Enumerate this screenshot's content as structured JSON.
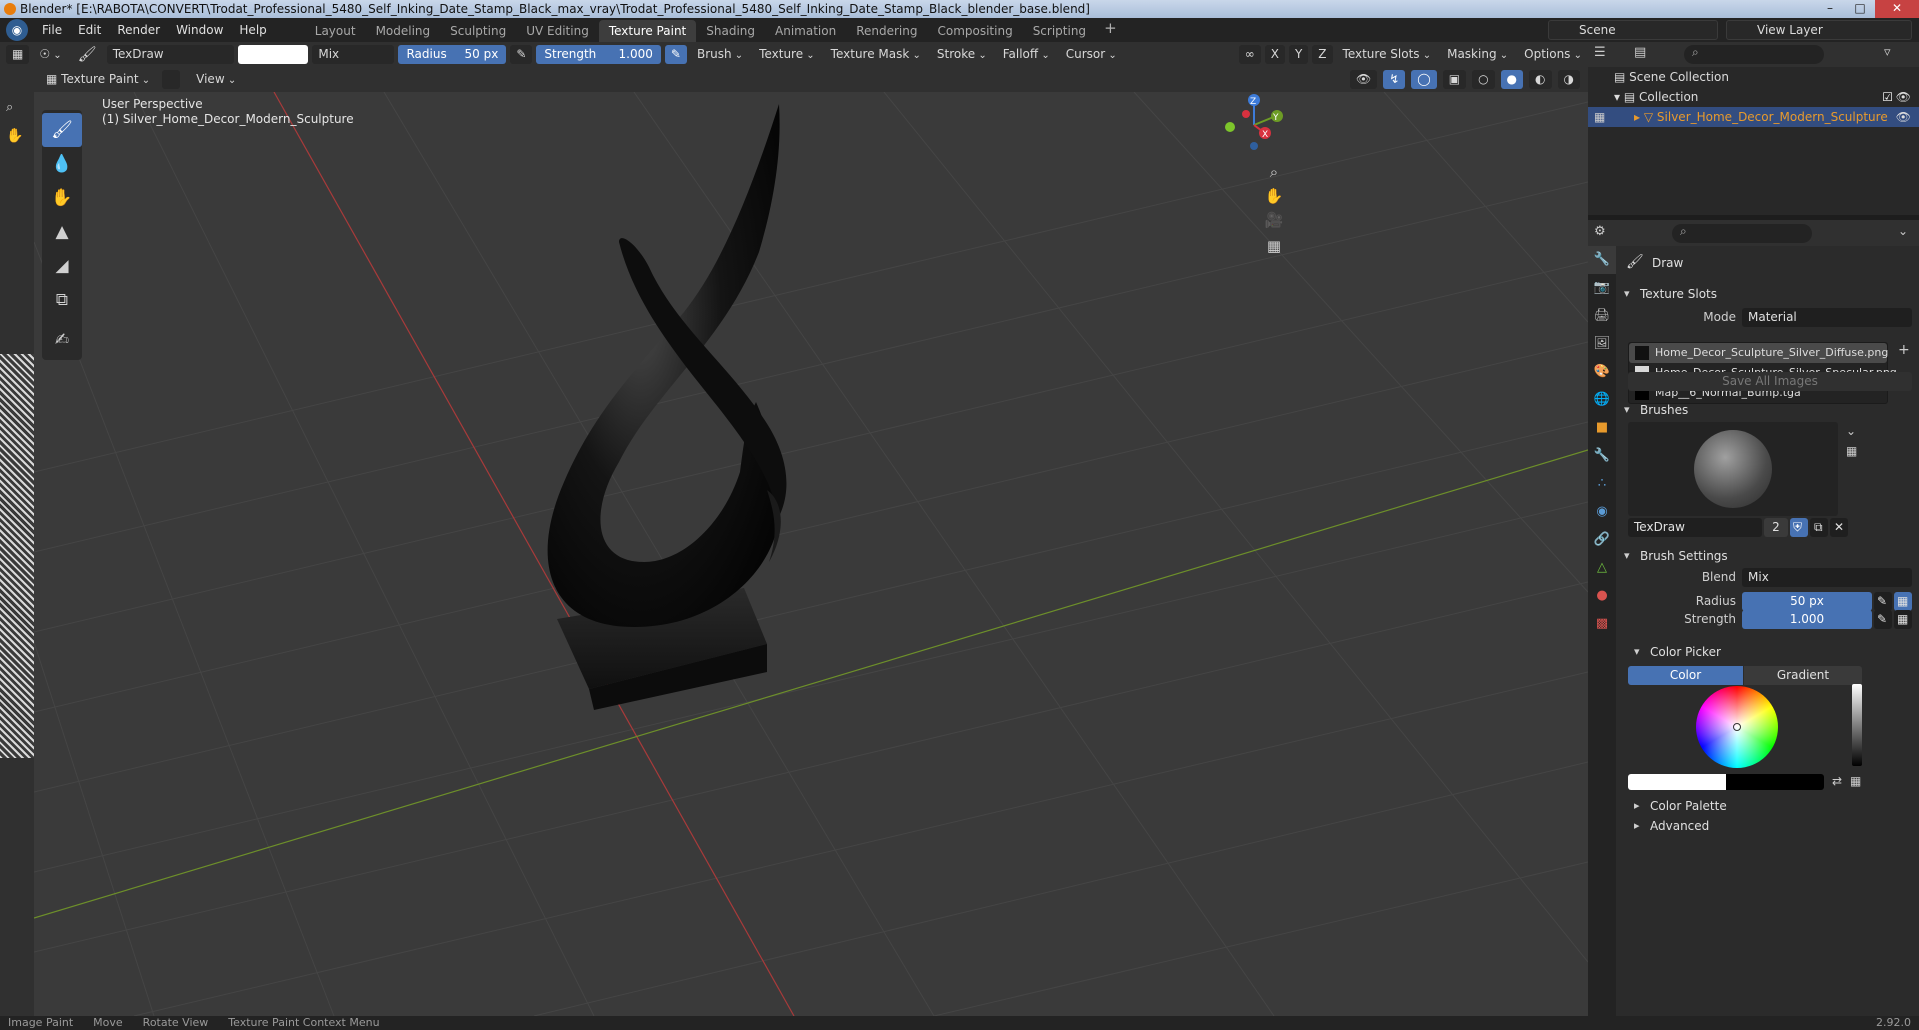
{
  "window": {
    "title": "Blender* [E:\\RABOTA\\CONVERT\\Trodat_Professional_5480_Self_Inking_Date_Stamp_Black_max_vray\\Trodat_Professional_5480_Self_Inking_Date_Stamp_Black_blender_base.blend]"
  },
  "menu": {
    "items": [
      "File",
      "Edit",
      "Render",
      "Window",
      "Help"
    ]
  },
  "workspaces": {
    "tabs": [
      "Layout",
      "Modeling",
      "Sculpting",
      "UV Editing",
      "Texture Paint",
      "Shading",
      "Animation",
      "Rendering",
      "Compositing",
      "Scripting"
    ],
    "active": "Texture Paint",
    "scene": "Scene",
    "view_layer": "View Layer"
  },
  "tool_header": {
    "brush_name": "TexDraw",
    "blend_mode": "Mix",
    "radius_label": "Radius",
    "radius_value": "50 px",
    "strength_label": "Strength",
    "strength_value": "1.000",
    "menus": [
      "Brush",
      "Texture",
      "Texture Mask",
      "Stroke",
      "Falloff",
      "Cursor"
    ],
    "axis": [
      "X",
      "Y",
      "Z"
    ],
    "right_menus": [
      "Texture Slots",
      "Masking",
      "Options"
    ]
  },
  "viewport_header": {
    "mode": "Texture Paint",
    "view_menu": "View"
  },
  "viewport": {
    "perspective": "User Perspective",
    "object_label": "(1) Silver_Home_Decor_Modern_Sculpture",
    "gizmo_axes": [
      "Z",
      "Y",
      "X"
    ],
    "colors": {
      "background": "#3a3a3a",
      "grid": "#454545",
      "x_axis": "#a83a3a",
      "y_axis": "#6d8f2a",
      "active_tool": "#4772b3"
    }
  },
  "toolbar": {
    "tools": [
      "draw-brush",
      "soften",
      "smear",
      "clone",
      "fill",
      "mask",
      "annotate"
    ]
  },
  "outliner": {
    "scene_collection": "Scene Collection",
    "collection": "Collection",
    "object": "Silver_Home_Decor_Modern_Sculpture"
  },
  "properties": {
    "tool_name": "Draw",
    "texture_slots": {
      "title": "Texture Slots",
      "mode_label": "Mode",
      "mode_value": "Material",
      "slots": [
        "Home_Decor_Sculpture_Silver_Diffuse.png",
        "Home_Decor_Sculpture_Silver_Specular.png",
        "Map__6_Normal_Bump.tga"
      ],
      "save_button": "Save All Images"
    },
    "brushes": {
      "title": "Brushes",
      "brush_name": "TexDraw",
      "users": "2"
    },
    "brush_settings": {
      "title": "Brush Settings",
      "blend_label": "Blend",
      "blend_value": "Mix",
      "radius_label": "Radius",
      "radius_value": "50 px",
      "strength_label": "Strength",
      "strength_value": "1.000"
    },
    "color_picker": {
      "title": "Color Picker",
      "tab_color": "Color",
      "tab_gradient": "Gradient"
    },
    "color_palette": "Color Palette",
    "advanced": "Advanced"
  },
  "status": {
    "items": [
      "Image Paint",
      "Move",
      "Rotate View",
      "Texture Paint Context Menu"
    ],
    "version": "2.92.0"
  }
}
